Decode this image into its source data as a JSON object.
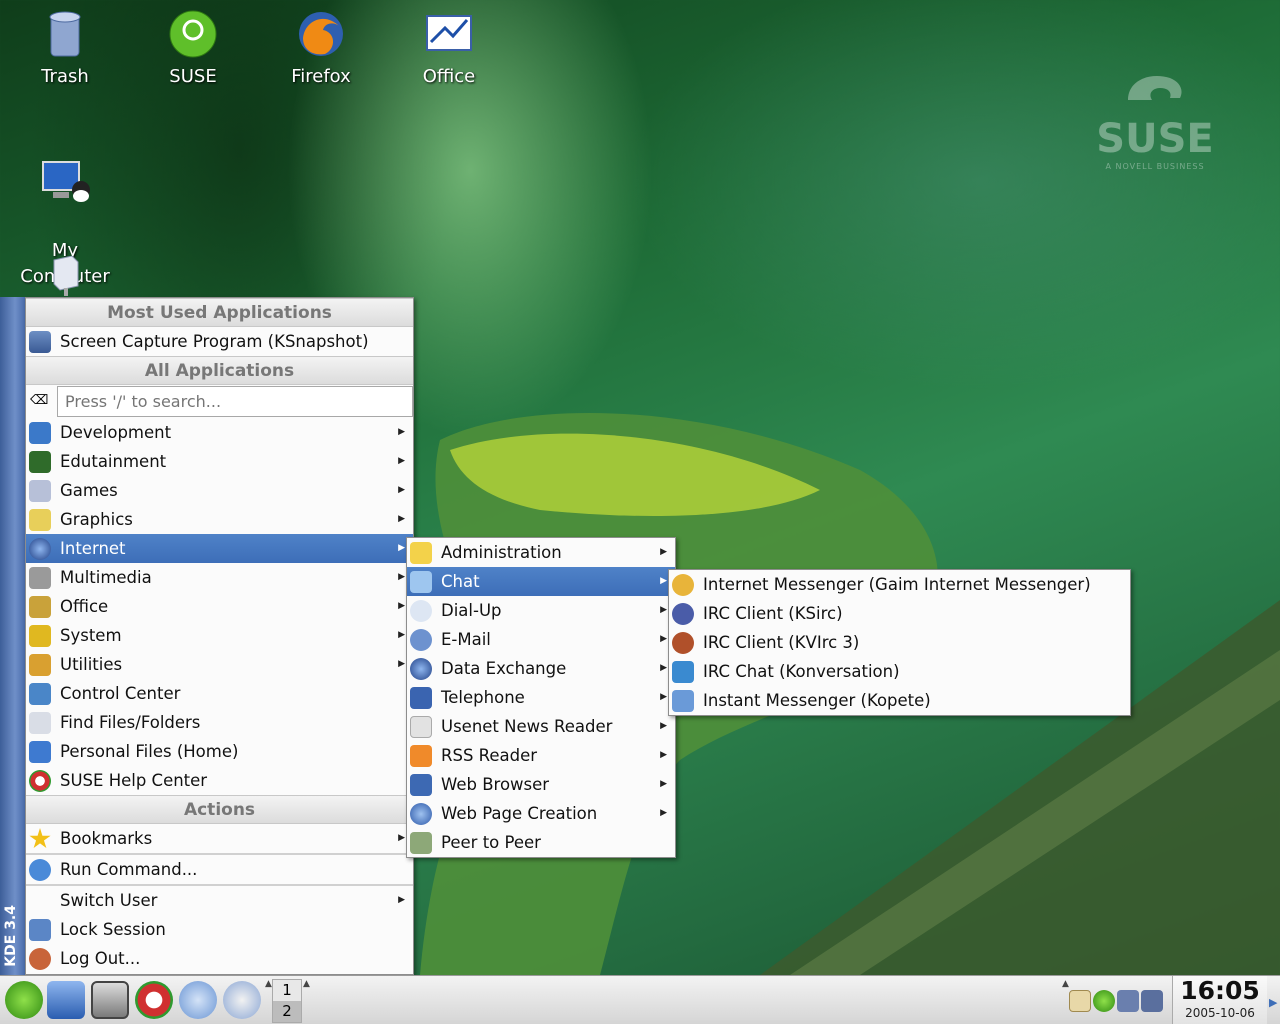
{
  "desktop": {
    "icons": [
      {
        "label": "Trash",
        "icon": "trash-icon"
      },
      {
        "label": "SUSE",
        "icon": "suse-icon"
      },
      {
        "label": "Firefox",
        "icon": "firefox-icon"
      },
      {
        "label": "Office",
        "icon": "office-icon"
      },
      {
        "label": "My\nComputer",
        "icon": "computer-icon"
      }
    ],
    "brand": {
      "name": "SUSE",
      "tagline": "A NOVELL BUSINESS"
    }
  },
  "kde_strip": {
    "version": "KDE 3.4"
  },
  "main_menu": {
    "most_used_header": "Most Used Applications",
    "most_used": [
      {
        "label": "Screen Capture Program (KSnapshot)",
        "icon": "camera-icon"
      }
    ],
    "all_apps_header": "All Applications",
    "search_placeholder": "Press '/' to search...",
    "categories": [
      {
        "label": "Development",
        "icon": "development-icon",
        "submenu": true
      },
      {
        "label": "Edutainment",
        "icon": "edutainment-icon",
        "submenu": true
      },
      {
        "label": "Games",
        "icon": "games-icon",
        "submenu": true
      },
      {
        "label": "Graphics",
        "icon": "graphics-icon",
        "submenu": true
      },
      {
        "label": "Internet",
        "icon": "internet-icon",
        "submenu": true,
        "selected": true
      },
      {
        "label": "Multimedia",
        "icon": "multimedia-icon",
        "submenu": true
      },
      {
        "label": "Office",
        "icon": "office-icon",
        "submenu": true
      },
      {
        "label": "System",
        "icon": "system-icon",
        "submenu": true
      },
      {
        "label": "Utilities",
        "icon": "utilities-icon",
        "submenu": true
      },
      {
        "label": "Control Center",
        "icon": "control-center-icon"
      },
      {
        "label": "Find Files/Folders",
        "icon": "find-icon"
      },
      {
        "label": "Personal Files (Home)",
        "icon": "home-icon"
      },
      {
        "label": "SUSE Help Center",
        "icon": "help-icon"
      }
    ],
    "actions_header": "Actions",
    "actions": [
      {
        "label": "Bookmarks",
        "icon": "bookmarks-icon",
        "submenu": true
      },
      {
        "label": "Run Command...",
        "icon": "run-icon"
      },
      {
        "label": "Switch User",
        "icon": "",
        "submenu": true
      },
      {
        "label": "Lock Session",
        "icon": "lock-icon"
      },
      {
        "label": "Log Out...",
        "icon": "logout-icon"
      }
    ]
  },
  "internet_menu": [
    {
      "label": "Administration",
      "icon": "admin-icon",
      "submenu": true
    },
    {
      "label": "Chat",
      "icon": "chat-icon",
      "submenu": true,
      "selected": true
    },
    {
      "label": "Dial-Up",
      "icon": "dialup-icon",
      "submenu": true
    },
    {
      "label": "E-Mail",
      "icon": "email-icon",
      "submenu": true
    },
    {
      "label": "Data Exchange",
      "icon": "data-exchange-icon",
      "submenu": true
    },
    {
      "label": "Telephone",
      "icon": "telephone-icon",
      "submenu": true
    },
    {
      "label": "Usenet News Reader",
      "icon": "news-icon",
      "submenu": true
    },
    {
      "label": "RSS Reader",
      "icon": "rss-icon",
      "submenu": true
    },
    {
      "label": "Web Browser",
      "icon": "browser-icon",
      "submenu": true
    },
    {
      "label": "Web Page Creation",
      "icon": "web-creation-icon",
      "submenu": true
    },
    {
      "label": "Peer to Peer",
      "icon": "p2p-icon"
    }
  ],
  "chat_menu": [
    {
      "label": "Internet Messenger (Gaim Internet Messenger)",
      "icon": "gaim-icon"
    },
    {
      "label": "IRC Client (KSirc)",
      "icon": "ksirc-icon"
    },
    {
      "label": "IRC Client (KVIrc 3)",
      "icon": "kvirc-icon"
    },
    {
      "label": "IRC Chat (Konversation)",
      "icon": "konversation-icon"
    },
    {
      "label": "Instant Messenger (Kopete)",
      "icon": "kopete-icon"
    }
  ],
  "taskbar": {
    "pager": [
      "1",
      "2"
    ],
    "clock_time": "16:05",
    "clock_date": "2005-10-06"
  },
  "colors": {
    "selection": "#3d6eb8",
    "menu_bg": "#fbfbfb",
    "strip": "#4a6cab"
  }
}
